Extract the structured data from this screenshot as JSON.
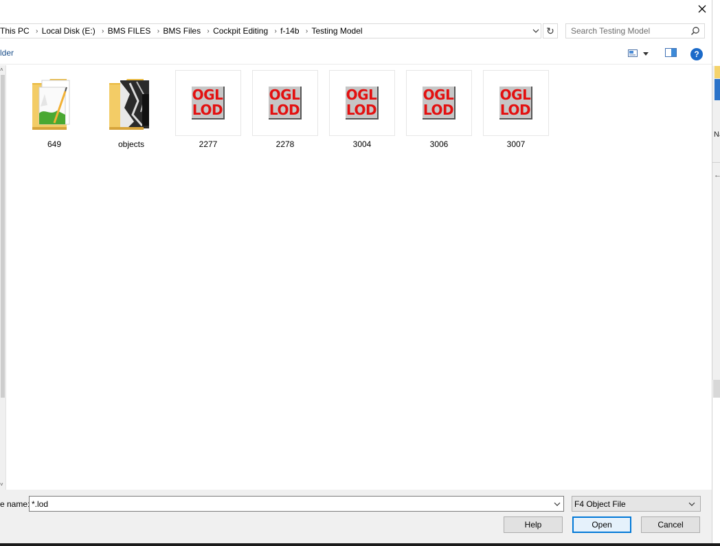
{
  "address_bar": {
    "crumbs": [
      "This PC",
      "Local Disk (E:)",
      "BMS FILES",
      "BMS Files",
      "Cockpit Editing",
      "f-14b",
      "Testing Model"
    ]
  },
  "search": {
    "placeholder": "Search Testing Model"
  },
  "toolbar": {
    "new_folder_label": "lder"
  },
  "items": [
    {
      "name": "649",
      "type": "folder"
    },
    {
      "name": "objects",
      "type": "folder"
    },
    {
      "name": "2277",
      "type": "lod",
      "icon_text": [
        "OGL",
        "LOD"
      ]
    },
    {
      "name": "2278",
      "type": "lod",
      "icon_text": [
        "OGL",
        "LOD"
      ]
    },
    {
      "name": "3004",
      "type": "lod",
      "icon_text": [
        "OGL",
        "LOD"
      ]
    },
    {
      "name": "3006",
      "type": "lod",
      "icon_text": [
        "OGL",
        "LOD"
      ]
    },
    {
      "name": "3007",
      "type": "lod",
      "icon_text": [
        "OGL",
        "LOD"
      ]
    }
  ],
  "file_name": {
    "label": "e name:",
    "value": "*.lod"
  },
  "file_type": {
    "selected": "F4 Object File"
  },
  "buttons": {
    "help": "Help",
    "open": "Open",
    "cancel": "Cancel"
  },
  "side_strip": {
    "text": "Na"
  },
  "icons": {
    "close": "close-icon",
    "search": "search-icon",
    "refresh": "refresh-icon",
    "help": "help-icon",
    "view": "view-menu-icon",
    "preview": "preview-pane-icon"
  },
  "colors": {
    "accent": "#0078d7",
    "help_blue": "#1b6ac9",
    "lod_text_red": "#e31010",
    "folder_yellow": "#f3cc66"
  }
}
